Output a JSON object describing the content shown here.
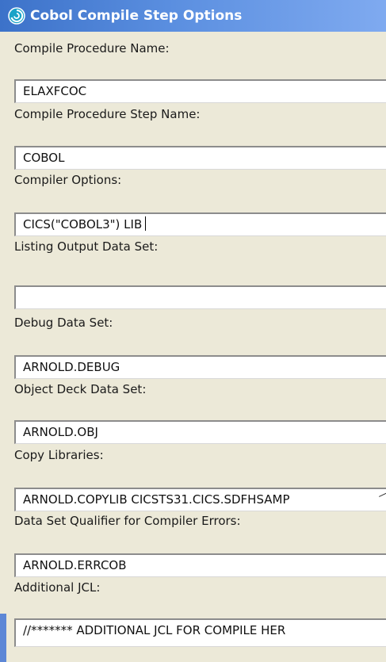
{
  "dialog": {
    "title": "Cobol Compile Step Options"
  },
  "fields": [
    {
      "label": "Compile Procedure Name:",
      "value": "ELAXFCOC"
    },
    {
      "label": "Compile Procedure Step Name:",
      "value": "COBOL"
    },
    {
      "label": "Compiler Options:",
      "value": "CICS(\"COBOL3\") LIB"
    },
    {
      "label": "Listing Output Data Set:",
      "value": ""
    },
    {
      "label": "Debug Data Set:",
      "value": "ARNOLD.DEBUG"
    },
    {
      "label": "Object Deck Data Set:",
      "value": "ARNOLD.OBJ"
    },
    {
      "label": "Copy Libraries:",
      "value": "ARNOLD.COPYLIB CICSTS31.CICS.SDFHSAMP"
    },
    {
      "label": "Data Set Qualifier for Compiler Errors:",
      "value": "ARNOLD.ERRCOB"
    },
    {
      "label": "Additional JCL:",
      "value": "//******* ADDITIONAL JCL FOR COMPILE HER"
    }
  ],
  "icons": {
    "title_icon": "swirl-app-icon"
  },
  "colors": {
    "titlebar": "#3c72c9",
    "background": "#ece9d8",
    "field_background": "#ffffff"
  }
}
